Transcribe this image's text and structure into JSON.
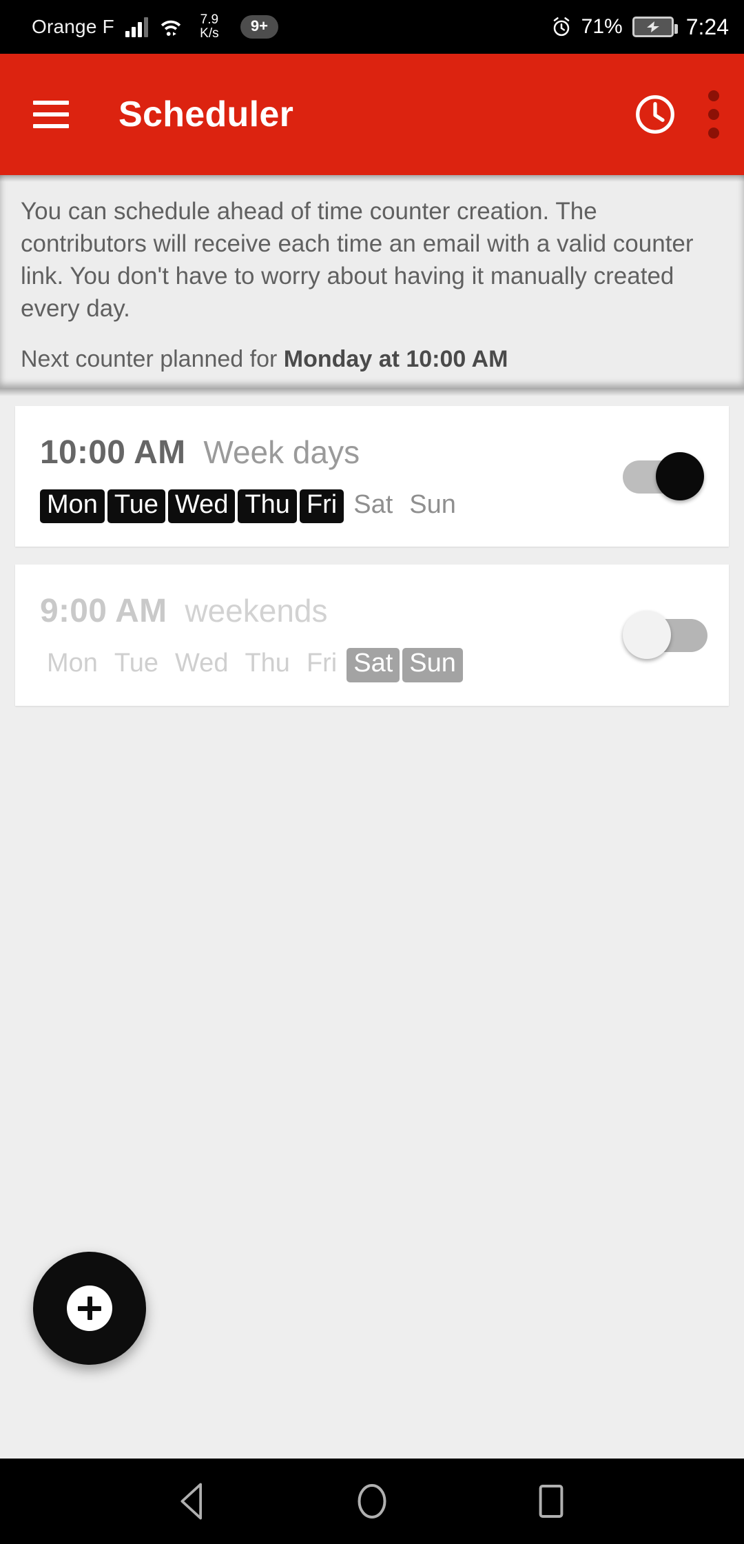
{
  "status_bar": {
    "carrier": "Orange F",
    "signal_icon": "signal-bars-icon",
    "wifi_icon": "wifi-icon",
    "net_speed_value": "7.9",
    "net_speed_unit": "K/s",
    "notification_badge": "9+",
    "alarm_icon": "alarm-clock-icon",
    "battery_percent": "71%",
    "battery_icon": "battery-charging-icon",
    "time": "7:24"
  },
  "app_bar": {
    "menu_icon": "hamburger-menu-icon",
    "title": "Scheduler",
    "clock_icon": "clock-icon",
    "overflow_icon": "overflow-menu-icon",
    "background_color": "#dc2310",
    "title_color": "#ffffff"
  },
  "info_panel": {
    "description": "You can schedule ahead of time counter creation. The contributors will receive each time an email with a valid counter link. You don't have to worry about having it manually created every day.",
    "next_prefix": "Next counter planned for ",
    "next_value": "Monday at 10:00 AM"
  },
  "schedules": [
    {
      "time": "10:00 AM",
      "label": "Week days",
      "enabled": true,
      "toggle_state": "on",
      "days": [
        {
          "name": "Mon",
          "selected": true
        },
        {
          "name": "Tue",
          "selected": true
        },
        {
          "name": "Wed",
          "selected": true
        },
        {
          "name": "Thu",
          "selected": true
        },
        {
          "name": "Fri",
          "selected": true
        },
        {
          "name": "Sat",
          "selected": false
        },
        {
          "name": "Sun",
          "selected": false
        }
      ]
    },
    {
      "time": "9:00 AM",
      "label": "weekends",
      "enabled": false,
      "toggle_state": "off",
      "days": [
        {
          "name": "Mon",
          "selected": false
        },
        {
          "name": "Tue",
          "selected": false
        },
        {
          "name": "Wed",
          "selected": false
        },
        {
          "name": "Thu",
          "selected": false
        },
        {
          "name": "Fri",
          "selected": false
        },
        {
          "name": "Sat",
          "selected": true
        },
        {
          "name": "Sun",
          "selected": true
        }
      ]
    }
  ],
  "fab": {
    "icon": "plus-icon",
    "color": "#0d0d0d"
  },
  "nav_bar": {
    "back_icon": "back-triangle-icon",
    "home_icon": "home-circle-icon",
    "recents_icon": "recents-square-icon"
  },
  "colors": {
    "accent": "#dc2310",
    "page_background": "#eeeeee",
    "card_background": "#ffffff",
    "day_selected_on": "#0d0d0d",
    "day_selected_off": "#a3a3a3"
  }
}
